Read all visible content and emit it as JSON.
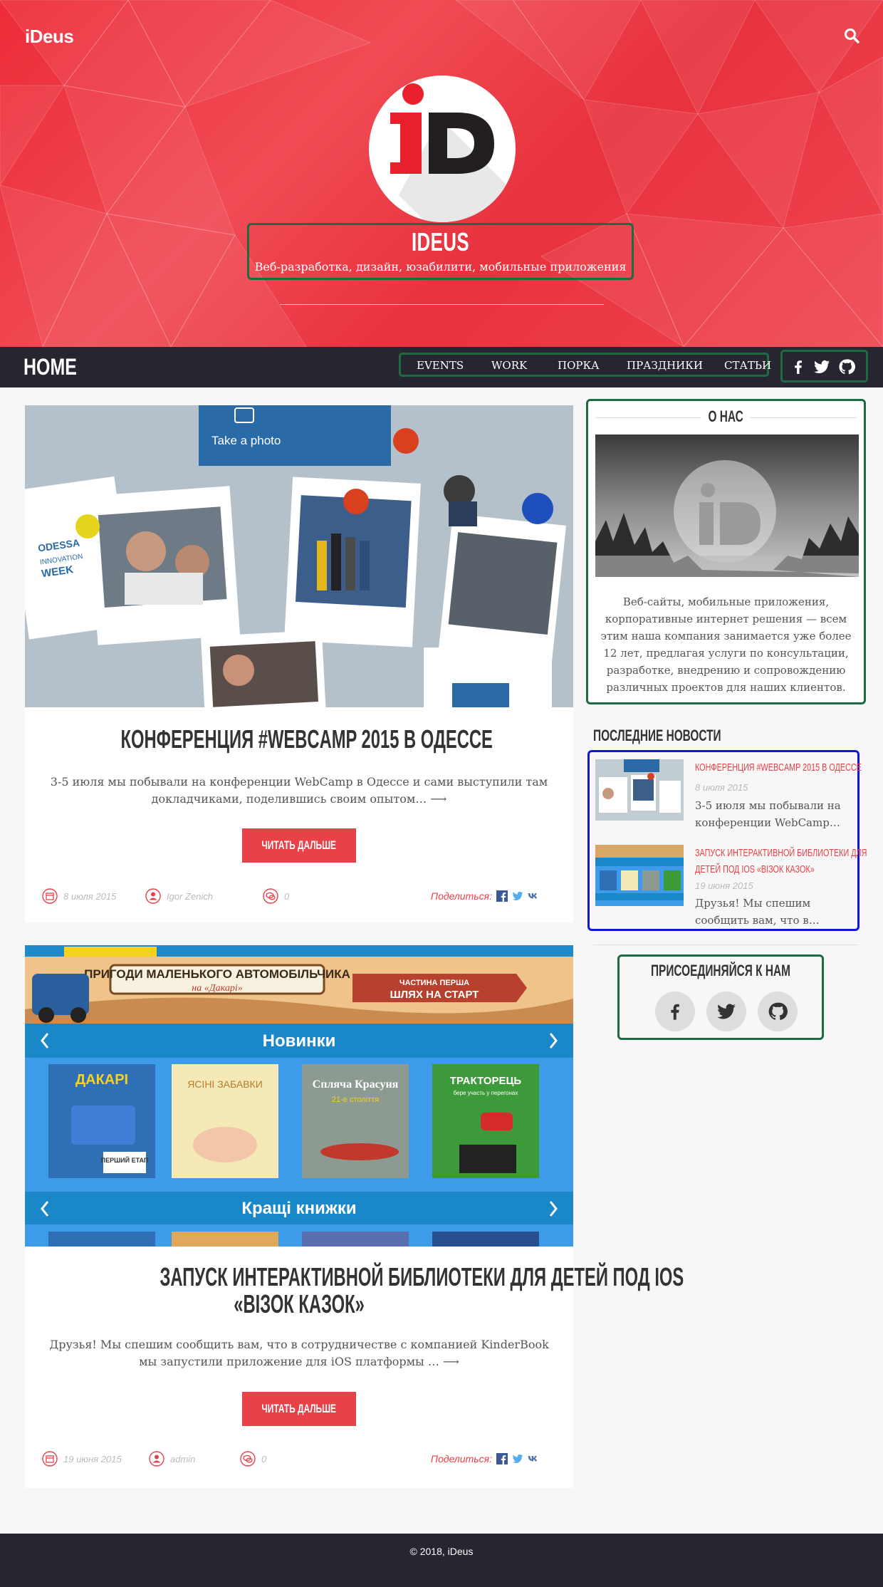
{
  "site": {
    "brand": "iDeus",
    "title": "IDEUS",
    "tagline": "Веб-разработка, дизайн, юзабилити, мобильные приложения"
  },
  "nav": {
    "home": "HOME",
    "items": [
      "EVENTS",
      "WORK",
      "ПОРКА",
      "ПРАЗДНИКИ",
      "СТАТЬИ"
    ],
    "social_icons": [
      "facebook-icon",
      "twitter-icon",
      "github-icon"
    ]
  },
  "posts": [
    {
      "title": "КОНФЕРЕНЦИЯ #WEBCAMP 2015 В ОДЕССЕ",
      "excerpt": "3-5 июля мы побывали на конференции WebCamp в Одессе и сами выступили там докладчиками, поделившись своим опытом… ⟶",
      "read_more": "ЧИТАТЬ ДАЛЬШЕ",
      "date": "8 июля 2015",
      "author": "Igor Zenich",
      "comments": "0",
      "share_label": "Поделиться:",
      "image_text": {
        "take_photo": "Take a photo",
        "odessa": "ODESSA",
        "innovation": "INNOVATION",
        "week": "WEEK"
      }
    },
    {
      "title_line1": "ЗАПУСК ИНТЕРАКТИВНОЙ БИБЛИОТЕКИ ДЛЯ ДЕТЕЙ ПОД IOS",
      "title_line2": "«ВІЗОК КАЗОК»",
      "excerpt": "Друзья! Мы спешим сообщить вам, что в сотрудничестве с компанией KinderBook мы запустили приложение для iOS платформы … ⟶",
      "read_more": "ЧИТАТЬ ДАЛЬШЕ",
      "date": "19 июня 2015",
      "author": "admin",
      "comments": "0",
      "share_label": "Поделиться:",
      "image_text": {
        "banner": "ПРИГОДИ МАЛЕНЬКОГО АВТОМОБІЛЬЧИКА",
        "banner_sub": "на «Дакарі»",
        "sign_top": "ЧАСТИНА ПЕРША",
        "sign_main": "ШЛЯХ НА СТАРТ",
        "new_books": "Новинки",
        "best_books": "Кращі книжки",
        "book1": "ДАКАРІ",
        "book1_tag": "ПЕРШИЙ ЕТАП",
        "book2": "ЯСІНІ ЗАБАВКИ",
        "book3": "Сплячa Красуня",
        "book3_sub": "21-е століття",
        "book4": "ТРАКТОРЕЦЬ",
        "book4_sub": "бере участь у перегонах"
      }
    }
  ],
  "sidebar": {
    "about_title": "О НАС",
    "about_text": "Веб-сайты, мобильные приложения, корпоративные интернет решения — всем этим наша компания занимается уже более 12 лет, предлагая услуги по консультации, разработке, внедрению и сопровождению различных проектов для наших клиентов.",
    "news_title": "ПОСЛЕДНИЕ НОВОСТИ",
    "news": [
      {
        "title_line1": "КОНФЕРЕНЦИЯ #WEBCAMP 2015 В ОДЕССЕ",
        "title_line2": "",
        "date": "8 июля 2015",
        "excerpt": "3-5 июля мы побывали на конференции WebCamp…"
      },
      {
        "title_line1": "ЗАПУСК ИНТЕРАКТИВНОЙ БИБЛИОТЕКИ ДЛЯ",
        "title_line2": "ДЕТЕЙ ПОД IOS «ВІЗОК КАЗОК»",
        "date": "19 июня 2015",
        "excerpt": "Друзья! Мы спешим сообщить вам, что в…"
      }
    ],
    "join_title": "ПРИСОЕДИНЯЙСЯ К НАМ"
  },
  "footer": {
    "copyright": "© 2018, iDeus"
  },
  "colors": {
    "accent": "#e84148",
    "hero_red": "#ec2b38",
    "dark": "#262630",
    "highlight_green": "#1e6b43",
    "highlight_blue": "#1414d6"
  }
}
